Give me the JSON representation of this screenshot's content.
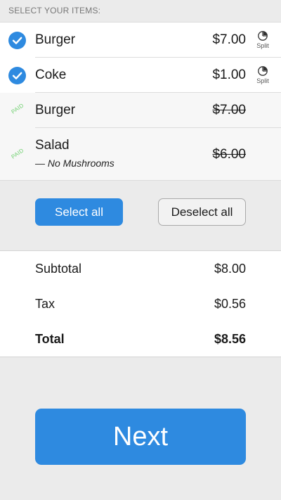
{
  "header": {
    "title": "SELECT YOUR ITEMS:"
  },
  "items": [
    {
      "name": "Burger",
      "price": "$7.00",
      "status": "selected",
      "split_label": "Split"
    },
    {
      "name": "Coke",
      "price": "$1.00",
      "status": "selected",
      "split_label": "Split"
    },
    {
      "name": "Burger",
      "price": "$7.00",
      "status": "paid",
      "paid_label": "PAID"
    },
    {
      "name": "Salad",
      "note": "— No Mushrooms",
      "price": "$6.00",
      "status": "paid",
      "paid_label": "PAID"
    }
  ],
  "actions": {
    "select_all_label": "Select all",
    "deselect_all_label": "Deselect all"
  },
  "totals": {
    "subtotal_label": "Subtotal",
    "subtotal_value": "$8.00",
    "tax_label": "Tax",
    "tax_value": "$0.56",
    "total_label": "Total",
    "total_value": "$8.56"
  },
  "footer": {
    "next_label": "Next"
  },
  "colors": {
    "accent": "#2e8ae0",
    "paid": "#6ed06e"
  }
}
